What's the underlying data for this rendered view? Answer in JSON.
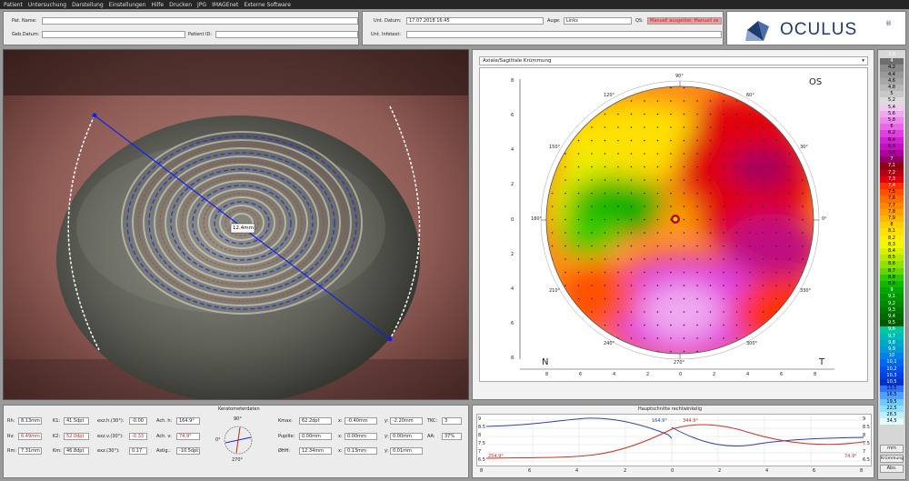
{
  "menu": [
    "Patient",
    "Untersuchung",
    "Darstellung",
    "Einstellungen",
    "Hilfe",
    "Drucken",
    "JPG",
    "IMAGEnet",
    "Externe Software"
  ],
  "patient": {
    "name_label": "Pat. Name:",
    "name_value": "",
    "birth_label": "Geb.Datum:",
    "birth_value": "",
    "id_label": "Patient ID:",
    "id_value": "",
    "exam_date_label": "Unt. Datum:",
    "exam_date_value": "17.07.2018 16:45",
    "eye_label": "Auge:",
    "eye_value": "Links",
    "qs_label": "QS:",
    "qs_value": "Manuell ausgelöst; Manuell ze",
    "info_label": "Unt. Infotext:",
    "info_value": ""
  },
  "brand": {
    "name": "OCULUS",
    "mark": "®",
    "color": "#1e3a6e"
  },
  "eye_image": {
    "measure_label": "12.4mm"
  },
  "topo_map": {
    "dropdown_value": "Axiale/Sagittale Krümmung",
    "eye_side": "OS",
    "nasal": "N",
    "temporal": "T",
    "angle_labels": [
      "90°",
      "60°",
      "30°",
      "0°",
      "330°",
      "300°",
      "270°",
      "240°",
      "210°",
      "180°",
      "150°",
      "120°"
    ],
    "y_ticks": [
      "8",
      "6",
      "4",
      "2",
      "0",
      "2",
      "4",
      "6",
      "8"
    ],
    "x_ticks": [
      "8",
      "6",
      "4",
      "2",
      "0",
      "2",
      "4",
      "6",
      "8"
    ]
  },
  "scale": {
    "values": [
      "3,8",
      "4",
      "4,2",
      "4,4",
      "4,6",
      "4,8",
      "5",
      "5,2",
      "5,4",
      "5,6",
      "5,8",
      "6",
      "6,2",
      "6,4",
      "6,6",
      "6,8",
      "7",
      "7,1",
      "7,2",
      "7,3",
      "7,4",
      "7,5",
      "7,6",
      "7,7",
      "7,8",
      "7,9",
      "8",
      "8,1",
      "8,2",
      "8,3",
      "8,4",
      "8,5",
      "8,6",
      "8,7",
      "8,8",
      "8,9",
      "9",
      "9,1",
      "9,2",
      "9,3",
      "9,4",
      "9,5",
      "9,6",
      "9,7",
      "9,8",
      "9,9",
      "10",
      "10,1",
      "10,2",
      "10,3",
      "10,5",
      "13,5",
      "16,5",
      "19,5",
      "22,5",
      "28,5",
      "34,5"
    ],
    "colors": [
      "#d8d8d8",
      "#6e6e6e",
      "#8a8a8a",
      "#9a9a9a",
      "#a8a8a8",
      "#b8b8b8",
      "#c8c8c8",
      "#dcdcdc",
      "#f0c8f0",
      "#f0a8f0",
      "#ee88ee",
      "#e868e8",
      "#e040e0",
      "#d020d0",
      "#c010c0",
      "#b000a0",
      "#900060",
      "#900010",
      "#b80010",
      "#e00010",
      "#ff3000",
      "#ff5000",
      "#ff7000",
      "#ff8800",
      "#ffa000",
      "#ffb800",
      "#ffd000",
      "#ffe000",
      "#fff000",
      "#f0f800",
      "#d8f000",
      "#b8e800",
      "#90e000",
      "#60d800",
      "#30c800",
      "#10b800",
      "#00a800",
      "#009800",
      "#008800",
      "#007800",
      "#006800",
      "#005800",
      "#00c8a0",
      "#00b8b8",
      "#00a8c8",
      "#0098d8",
      "#0080e8",
      "#0068f0",
      "#0050f0",
      "#0040e0",
      "#0030c8",
      "#3070ff",
      "#50a0ff",
      "#70c8ff",
      "#90e0ff",
      "#c0f0ff",
      "#e0ffff"
    ],
    "unit_btn": "mm",
    "curve_btn": "Krümmung",
    "abs_btn": "Abs."
  },
  "kerato": {
    "title": "Keratometerdaten",
    "rh_label": "Rh:",
    "rh": "8.13mm",
    "rv_label": "Rv:",
    "rv": "6.49mm",
    "rm_label": "Rm:",
    "rm": "7.31mm",
    "k1_label": "K1:",
    "k1": "41.5dpt",
    "k2_label": "K2:",
    "k2": "52.0dpt",
    "km_label": "Km:",
    "km": "46.8dpt",
    "exzh_label": "exz.h.(30°):",
    "exzh": "-0.00",
    "exzv_label": "exz.v.(30°):",
    "exzv": "-0.33",
    "exz_label": "exz.(30°):",
    "exz": "0.17",
    "achh_label": "Ach. h:",
    "achh": "164.9°",
    "achv_label": "Ach. v:",
    "achv": "74.9°",
    "astig_label": "Astig.:",
    "astig": "-10.5dpt",
    "mini_top": "90°",
    "mini_bottom": "270°",
    "mini_left": "0°",
    "kmax_label": "Kmax:",
    "kmax": "62.2dpt",
    "pupille_label": "Pupille:",
    "pupille": "0.00mm",
    "dhh_label": "ØHH:",
    "dhh": "12.34mm",
    "x1_label": "x:",
    "x1": "-0.40mm",
    "y1_label": "y:",
    "y1": "-2.20mm",
    "x2_label": "x:",
    "x2": "0.00mm",
    "y2_label": "y:",
    "y2": "0.00mm",
    "x3_label": "x:",
    "x3": "0.13mm",
    "y3_label": "y:",
    "y3": "0.01mm",
    "tkc_label": "TKC:",
    "tkc": "3",
    "aa_label": "AA:",
    "aa": "37%"
  },
  "profile": {
    "title": "Hauptschnitte rechtwinkelig",
    "y_ticks": [
      "9",
      "8.5",
      "8",
      "7.5",
      "7",
      "6.5"
    ],
    "right_ticks": [
      "9",
      "8.5",
      "8",
      "7.5",
      "7",
      "6.5"
    ],
    "x_ticks": [
      "8",
      "6",
      "4",
      "2",
      "0",
      "2",
      "4",
      "6",
      "8"
    ],
    "blue_label": "164.9°",
    "red_label_top": "344.9°",
    "red_label_left": "254.9°",
    "red_label_right": "74.9°"
  }
}
